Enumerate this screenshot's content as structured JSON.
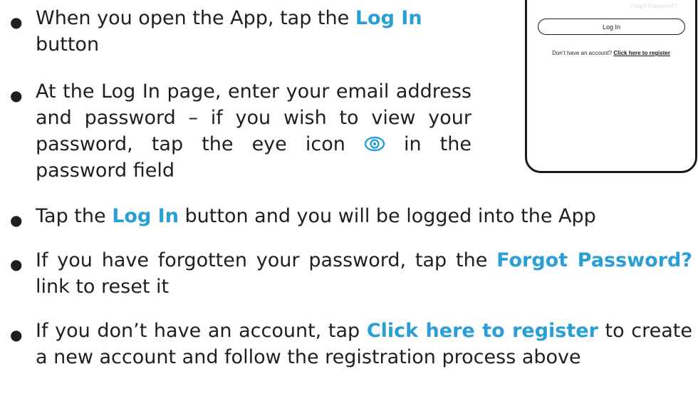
{
  "instructions": [
    {
      "before": "When you open the App, tap the ",
      "highlight": "Log In",
      "after": " button"
    },
    {
      "text_main": "At the Log In page, enter your email address and password – if you wish to view your password, tap the eye icon",
      "text_end": " in the password field"
    },
    {
      "before": "Tap the ",
      "highlight": "Log In",
      "after": " button and you will be logged into the App"
    },
    {
      "before": "If you have forgotten your password, tap the ",
      "highlight": "Forgot Password?",
      "after": " link to reset it"
    },
    {
      "before": "If you don’t have an account, tap ",
      "highlight": "Click here to register",
      "after": " to create a new account and follow the registration process above"
    }
  ],
  "bullet_symbol": "●",
  "phone": {
    "forgot_password_label": "Forgot Password?",
    "login_button_label": "Log In",
    "register_prompt": "Don’t have an account? ",
    "register_link_label": "Click here to register"
  },
  "colors": {
    "highlight": "#2a9fd6",
    "text": "#1f1f1f",
    "phone_frame": "#1a1a1a"
  },
  "icons": {
    "eye": "eye-icon"
  }
}
